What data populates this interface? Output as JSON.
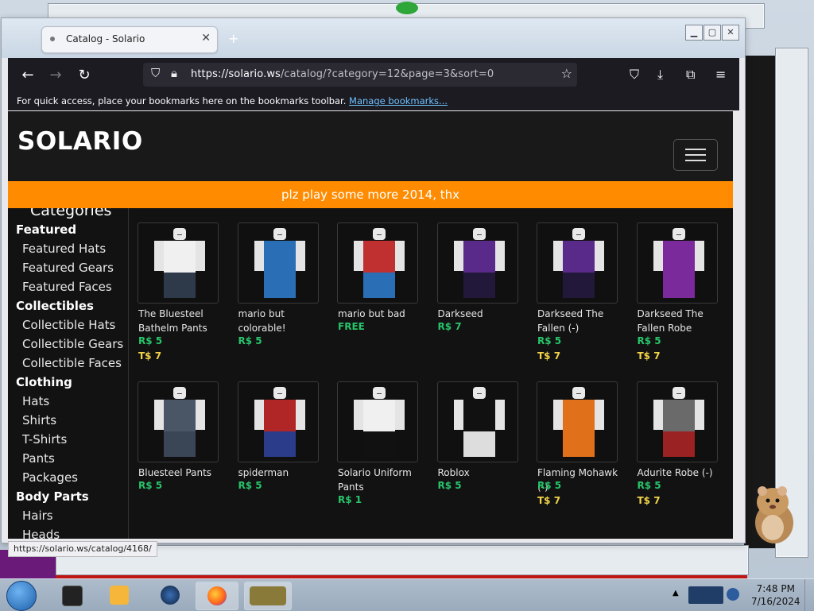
{
  "browser": {
    "tab_title": "Catalog - Solario",
    "tab_close": "✕",
    "new_tab": "+",
    "url_host": "https://solario.ws",
    "url_path": "/catalog/?category=12&page=3&sort=0",
    "bookmarks_text": "For quick access, place your bookmarks here on the bookmarks toolbar.",
    "bookmarks_link": "Manage bookmarks...",
    "status_url": "https://solario.ws/catalog/4168/"
  },
  "site": {
    "logo": "SOLARIO",
    "banner": "plz play some more 2014, thx",
    "accent": "#ff8c00"
  },
  "sidebar": {
    "heading": "Categories",
    "items": [
      {
        "label": "Featured",
        "kind": "cat"
      },
      {
        "label": "Featured Hats",
        "kind": "sub"
      },
      {
        "label": "Featured Gears",
        "kind": "sub"
      },
      {
        "label": "Featured Faces",
        "kind": "sub"
      },
      {
        "label": "Collectibles",
        "kind": "cat"
      },
      {
        "label": "Collectible Hats",
        "kind": "sub"
      },
      {
        "label": "Collectible Gears",
        "kind": "sub"
      },
      {
        "label": "Collectible Faces",
        "kind": "sub"
      },
      {
        "label": "Clothing",
        "kind": "cat"
      },
      {
        "label": "Hats",
        "kind": "sub"
      },
      {
        "label": "Shirts",
        "kind": "sub"
      },
      {
        "label": "T-Shirts",
        "kind": "sub"
      },
      {
        "label": "Pants",
        "kind": "sub"
      },
      {
        "label": "Packages",
        "kind": "sub"
      },
      {
        "label": "Body Parts",
        "kind": "cat"
      },
      {
        "label": "Hairs",
        "kind": "sub"
      },
      {
        "label": "Heads",
        "kind": "sub"
      }
    ]
  },
  "catalog": {
    "items": [
      {
        "name": "The Bluesteel Bathelm Pants",
        "prices": [
          "R$ 5",
          "T$ 7"
        ],
        "legs": "#2e3a4a",
        "torso": "#f0f0f0"
      },
      {
        "name": "mario but colorable!",
        "prices": [
          "R$ 5"
        ],
        "legs": "#2a6fb5",
        "torso": "#2a6fb5"
      },
      {
        "name": "mario but bad",
        "prices": [
          "FREE"
        ],
        "legs": "#2a6fb5",
        "torso": "#c03030"
      },
      {
        "name": "Darkseed",
        "prices": [
          "R$ 7"
        ],
        "legs": "#22183a",
        "torso": "#5a2a8a"
      },
      {
        "name": "Darkseed The Fallen (-)",
        "prices": [
          "R$ 5",
          "T$ 7"
        ],
        "legs": "#22183a",
        "torso": "#5a2a8a"
      },
      {
        "name": "Darkseed The Fallen Robe",
        "prices": [
          "R$ 5",
          "T$ 7"
        ],
        "legs": "#7a2a9a",
        "torso": "#7a2a9a"
      },
      {
        "name": "Bluesteel Pants",
        "prices": [
          "R$ 5"
        ],
        "legs": "#3a4656",
        "torso": "#4a5666"
      },
      {
        "name": "spiderman",
        "prices": [
          "R$ 5"
        ],
        "legs": "#2a3c8a",
        "torso": "#b02626"
      },
      {
        "name": "Solario Uniform Pants",
        "prices": [
          "R$ 1"
        ],
        "legs": "#111111",
        "torso": "#f0f0f0"
      },
      {
        "name": "Roblox",
        "prices": [
          "R$ 5"
        ],
        "legs": "#dddddd",
        "torso": "#111111"
      },
      {
        "name": "Flaming Mohawk (-)",
        "prices": [
          "R$ 5",
          "T$ 7"
        ],
        "legs": "#e0701a",
        "torso": "#e0701a"
      },
      {
        "name": "Adurite Robe (-)",
        "prices": [
          "R$ 5",
          "T$ 7"
        ],
        "legs": "#9a2222",
        "torso": "#6a6a6a"
      }
    ]
  },
  "taskbar": {
    "time": "7:48 PM",
    "date": "7/16/2024"
  }
}
